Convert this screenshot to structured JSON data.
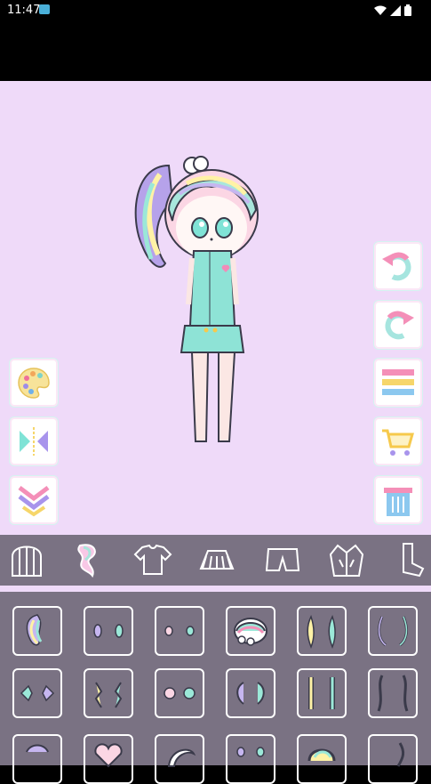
{
  "status_bar": {
    "time": "11:47",
    "icons": [
      "notification-icon",
      "wifi-icon",
      "signal-icon",
      "battery-icon"
    ]
  },
  "colors": {
    "stage_bg": "#efdaf9",
    "panel_bg": "#7a7283",
    "top_bar": "#000000"
  },
  "left_tools": [
    {
      "name": "palette",
      "icon": "palette-icon"
    },
    {
      "name": "flip",
      "icon": "flip-icon"
    },
    {
      "name": "collapse",
      "icon": "chevron-down-icon"
    }
  ],
  "right_tools": [
    {
      "name": "undo",
      "icon": "undo-icon"
    },
    {
      "name": "redo",
      "icon": "redo-icon"
    },
    {
      "name": "menu",
      "icon": "menu-icon"
    },
    {
      "name": "shop",
      "icon": "cart-icon"
    },
    {
      "name": "delete",
      "icon": "trash-icon"
    }
  ],
  "category_tabs": [
    {
      "name": "back-hair",
      "icon": "back-hair-icon",
      "selected": false
    },
    {
      "name": "side-hair",
      "icon": "side-hair-icon",
      "selected": true
    },
    {
      "name": "top",
      "icon": "shirt-icon",
      "selected": false
    },
    {
      "name": "skirt",
      "icon": "skirt-icon",
      "selected": false
    },
    {
      "name": "pants",
      "icon": "shorts-icon",
      "selected": false
    },
    {
      "name": "jacket",
      "icon": "jacket-icon",
      "selected": false
    },
    {
      "name": "socks",
      "icon": "socks-icon",
      "selected": false
    }
  ],
  "item_grid": {
    "columns": 6,
    "items": [
      "ponytail-hair",
      "small-side-tufts",
      "tiny-side-tufts",
      "bun-hair-selected",
      "long-side-locks",
      "curled-side-locks",
      "wing-tufts",
      "ribbon-tufts",
      "round-tufts",
      "curl-tufts",
      "braid-side-locks",
      "long-wavy-locks",
      "hair-item-13",
      "heart-bun",
      "crescent-lock",
      "twin-tufts",
      "swirl-hair",
      "thin-lock"
    ]
  }
}
